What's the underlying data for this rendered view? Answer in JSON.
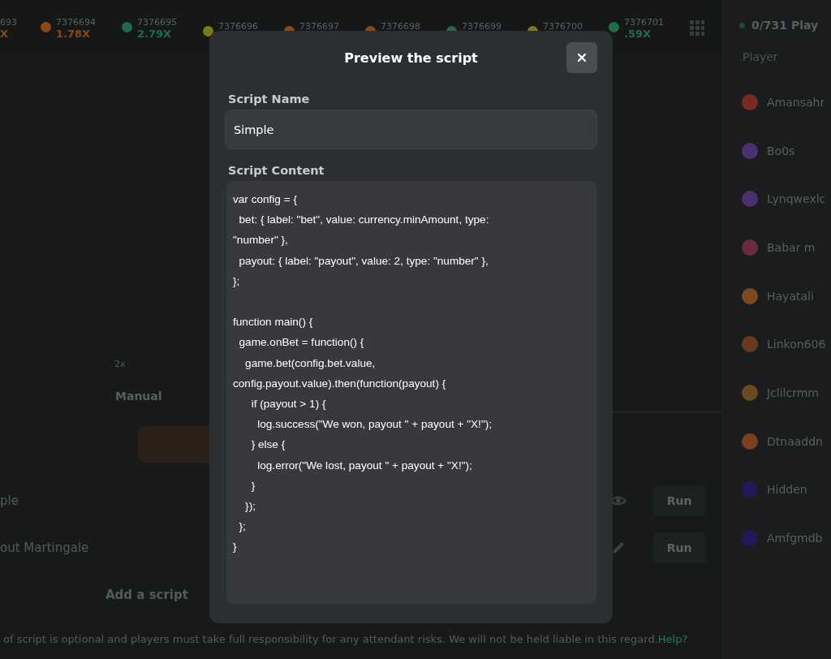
{
  "history": [
    {
      "id": "693",
      "multiplier": "X"
    },
    {
      "id": "7376694",
      "multiplier": "1.78X",
      "color": "#8a4a16"
    },
    {
      "id": "7376695",
      "multiplier": "2.79X",
      "color": "#1f6b4a"
    },
    {
      "id": "7376696",
      "color": "#7a7a1a"
    },
    {
      "id": "7376697",
      "color": "#8a4a16"
    },
    {
      "id": "7376698",
      "color": "#8a4a16"
    },
    {
      "id": "7376699",
      "color": "#1f6b4a"
    },
    {
      "id": "7376700",
      "color": "#7a7a1a"
    },
    {
      "id": "7376701",
      "multiplier": ".59X",
      "color": "#1f6b4a"
    }
  ],
  "game": {
    "multiplier_option": "2x",
    "mode_tab": "Manual"
  },
  "scripts": [
    {
      "name": "ple",
      "kind": "view",
      "action": "Run"
    },
    {
      "name": "out Martingale",
      "kind": "edit",
      "action": "Run"
    }
  ],
  "add_script": "Add a script",
  "disclaimer": {
    "text": "of script is optional and players must take full responsibility for any attendant risks. We will not be held liable in this regard.",
    "link": "Help?"
  },
  "players": {
    "count": "0/731 Play",
    "column": "Player",
    "rows": [
      {
        "name": "Amansahr",
        "color": "#7a2a22"
      },
      {
        "name": "Bo0s",
        "color": "#4a3070"
      },
      {
        "name": "Lynqwexlc",
        "color": "#4a3070"
      },
      {
        "name": "Babar m",
        "color": "#6a2a40"
      },
      {
        "name": "Hayatali",
        "color": "#7a4a20"
      },
      {
        "name": "Linkon606",
        "color": "#6a3a20"
      },
      {
        "name": "Jclilcrmm",
        "color": "#6a4a20"
      },
      {
        "name": "Dtnaaddn",
        "color": "#7a4020"
      },
      {
        "name": "Hidden",
        "color": "#24185a"
      },
      {
        "name": "Amfgmdb",
        "color": "#24185a"
      }
    ]
  },
  "modal": {
    "title": "Preview the script",
    "name_label": "Script Name",
    "name_value": "Simple",
    "content_label": "Script Content",
    "code": "var config = {\n  bet: { label: \"bet\", value: currency.minAmount, type:\n\"number\" },\n  payout: { label: \"payout\", value: 2, type: \"number\" },\n};\n\nfunction main() {\n  game.onBet = function() {\n    game.bet(config.bet.value,\nconfig.payout.value).then(function(payout) {\n      if (payout > 1) {\n        log.success(\"We won, payout \" + payout + \"X!\");\n      } else {\n        log.error(\"We lost, payout \" + payout + \"X!\");\n      }\n    });\n  };\n}"
  }
}
